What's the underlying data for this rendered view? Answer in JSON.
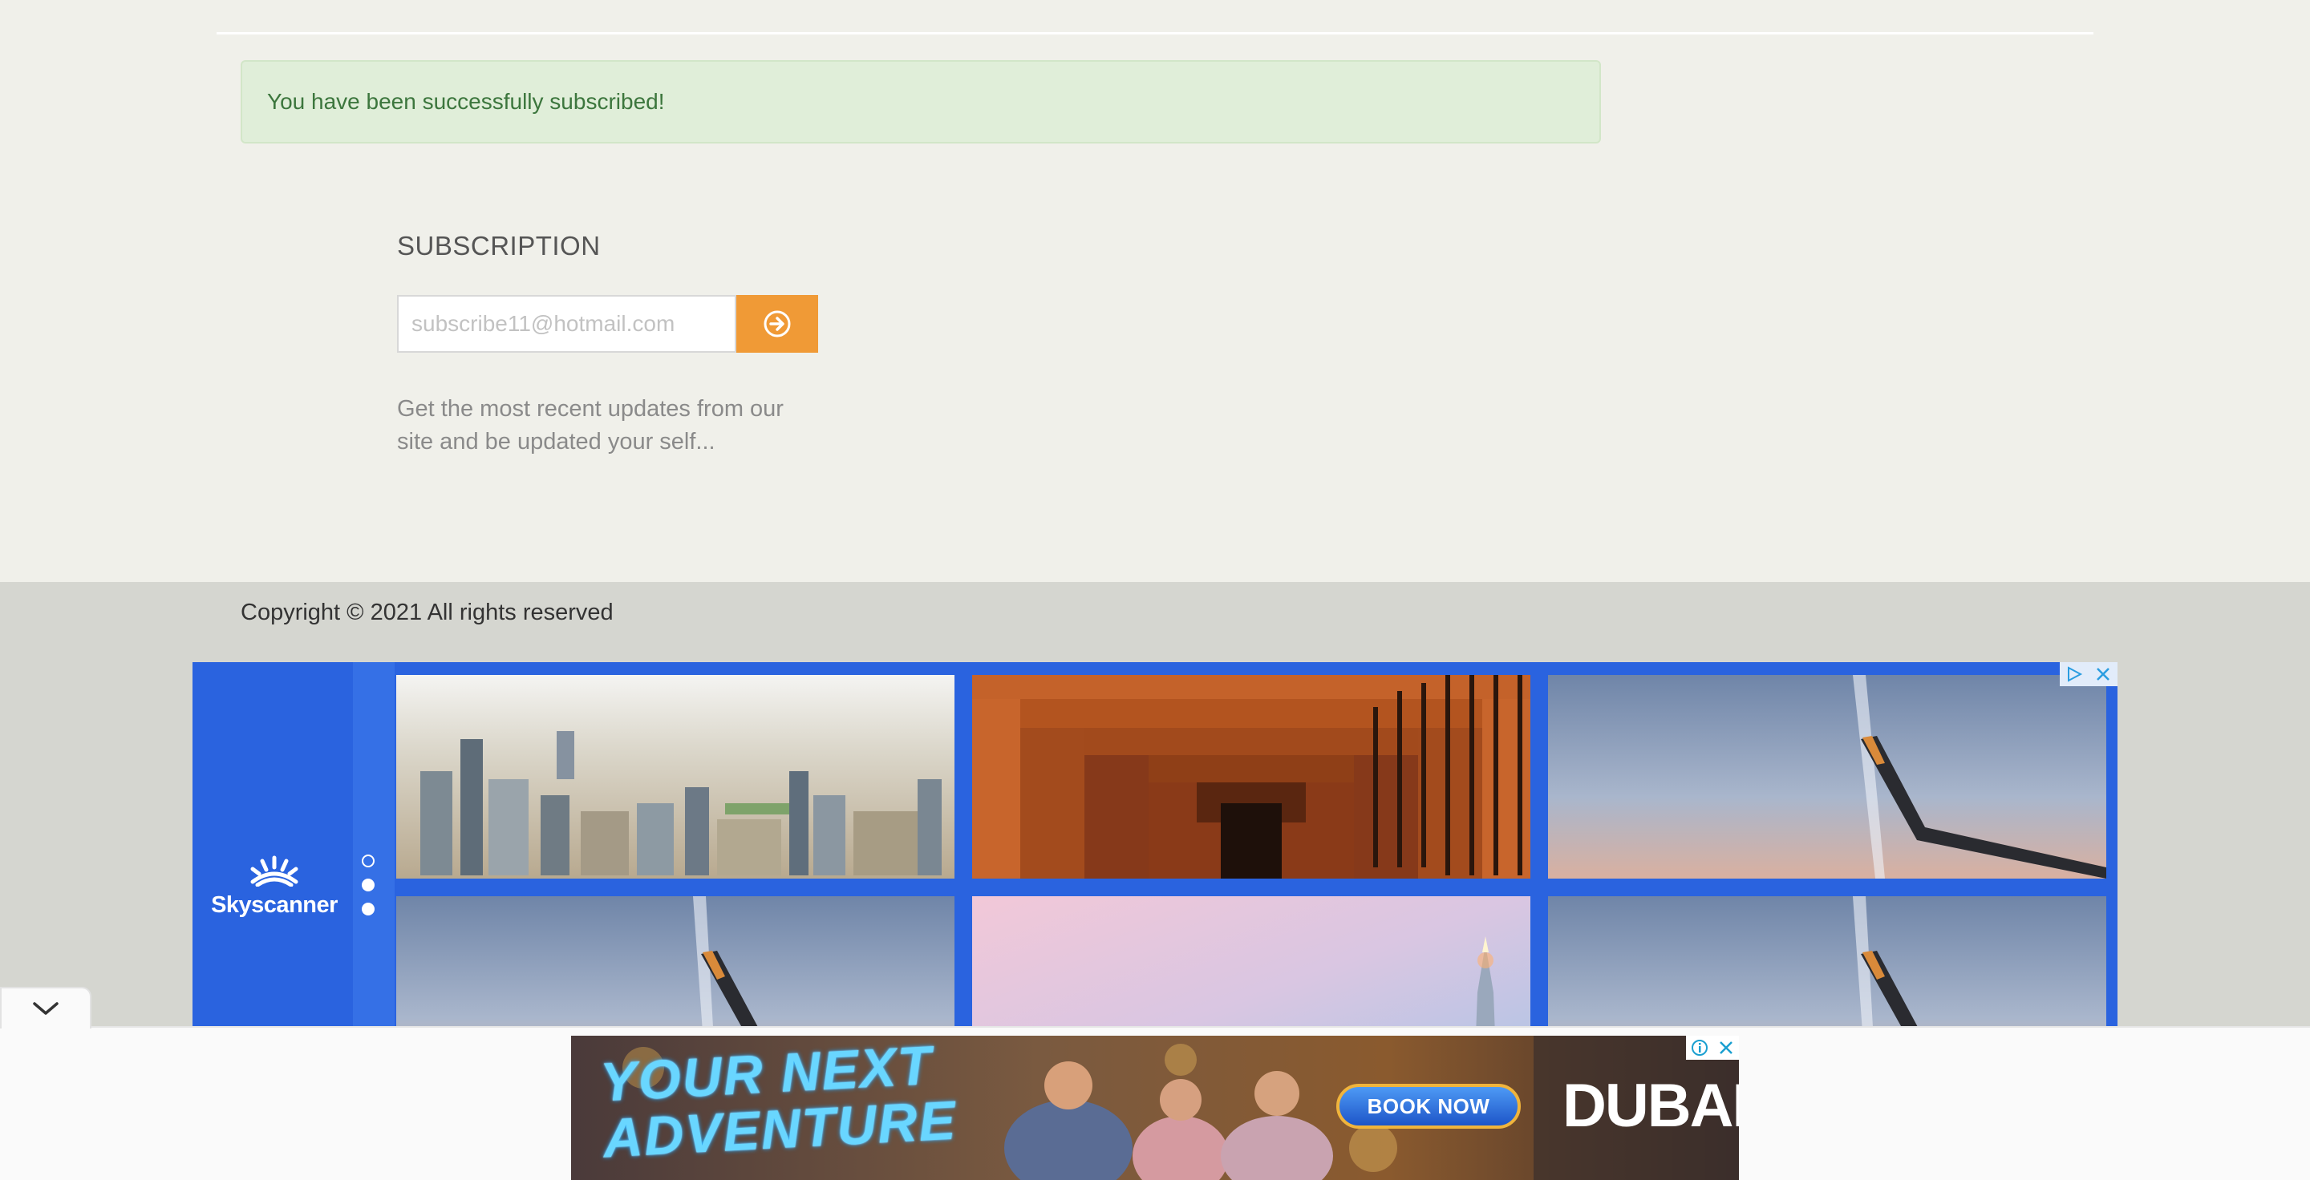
{
  "alert": {
    "message": "You have been successfully subscribed!"
  },
  "subscription": {
    "title": "SUBSCRIPTION",
    "email_placeholder": "subscribe11@hotmail.com",
    "submit_icon": "arrow-circle-right-icon",
    "description": "Get the most recent updates from our site and be updated your self..."
  },
  "footer": {
    "copyright": "Copyright © 2021 All rights reserved"
  },
  "skyscanner_ad": {
    "brand": "Skyscanner",
    "carousel_dots": 3,
    "active_dot": 1,
    "tiles": [
      "city-skyline-photo",
      "torii-gates-photo",
      "airplane-wing-photo",
      "airplane-wing-photo",
      "pink-sky-tower-photo",
      "airplane-wing-photo"
    ],
    "controls": [
      "adchoices-icon",
      "close-icon"
    ],
    "brand_color": "#2a63df"
  },
  "bottom_banner": {
    "headline_line1": "YOUR NEXT",
    "headline_line2": "ADVENTURE",
    "cta": "BOOK NOW",
    "destination": "DUBAI",
    "controls": [
      "info-icon",
      "close-icon"
    ]
  },
  "collapse_toggle": {
    "icon": "chevron-down-icon"
  }
}
